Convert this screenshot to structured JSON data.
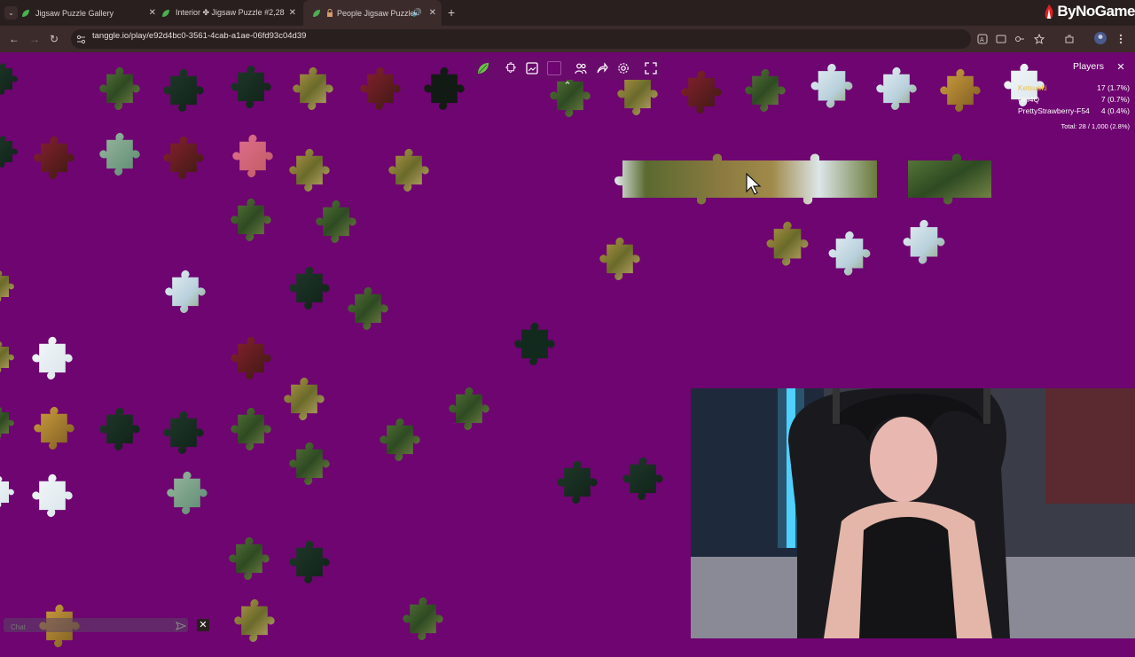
{
  "browser": {
    "tabs": [
      {
        "title": "Jigsaw Puzzle Gallery",
        "active": false
      },
      {
        "title": "Interior ✤ Jigsaw Puzzle #2,28",
        "active": false
      },
      {
        "title": "People Jigsaw Puzzle",
        "active": true
      }
    ],
    "new_tab_glyph": "+",
    "close_glyph": "✕",
    "url": "tanggle.io/play/e92d4bc0-3561-4cab-a1ae-06fd93c04d39",
    "back_glyph": "←",
    "forward_glyph": "→",
    "reload_glyph": "↻"
  },
  "stream": {
    "brand": "ByNoGame"
  },
  "puzzle": {
    "collapse_glyph": "⌃",
    "toolbar_icons": [
      "leaf-logo-icon",
      "piece-outline-icon",
      "image-preview-icon",
      "background-color-icon",
      "players-icon",
      "share-icon",
      "settings-icon",
      "fullscreen-icon"
    ],
    "background_color": "#6e0570"
  },
  "players": {
    "title": "Players",
    "close_glyph": "✕",
    "list": [
      {
        "name": "Ketsueki",
        "score": "17 (1.7%)",
        "color": "#f0c040"
      },
      {
        "name": "Uni4Q",
        "score": "7 (0.7%)",
        "color": "#ffffff"
      },
      {
        "name": "PrettyStrawberry-F54",
        "score": "4 (0.4%)",
        "color": "#ffffff"
      }
    ],
    "total": "Total: 28 / 1,000 (2.8%)"
  },
  "chat": {
    "placeholder": "Chat",
    "close_glyph": "✕"
  }
}
